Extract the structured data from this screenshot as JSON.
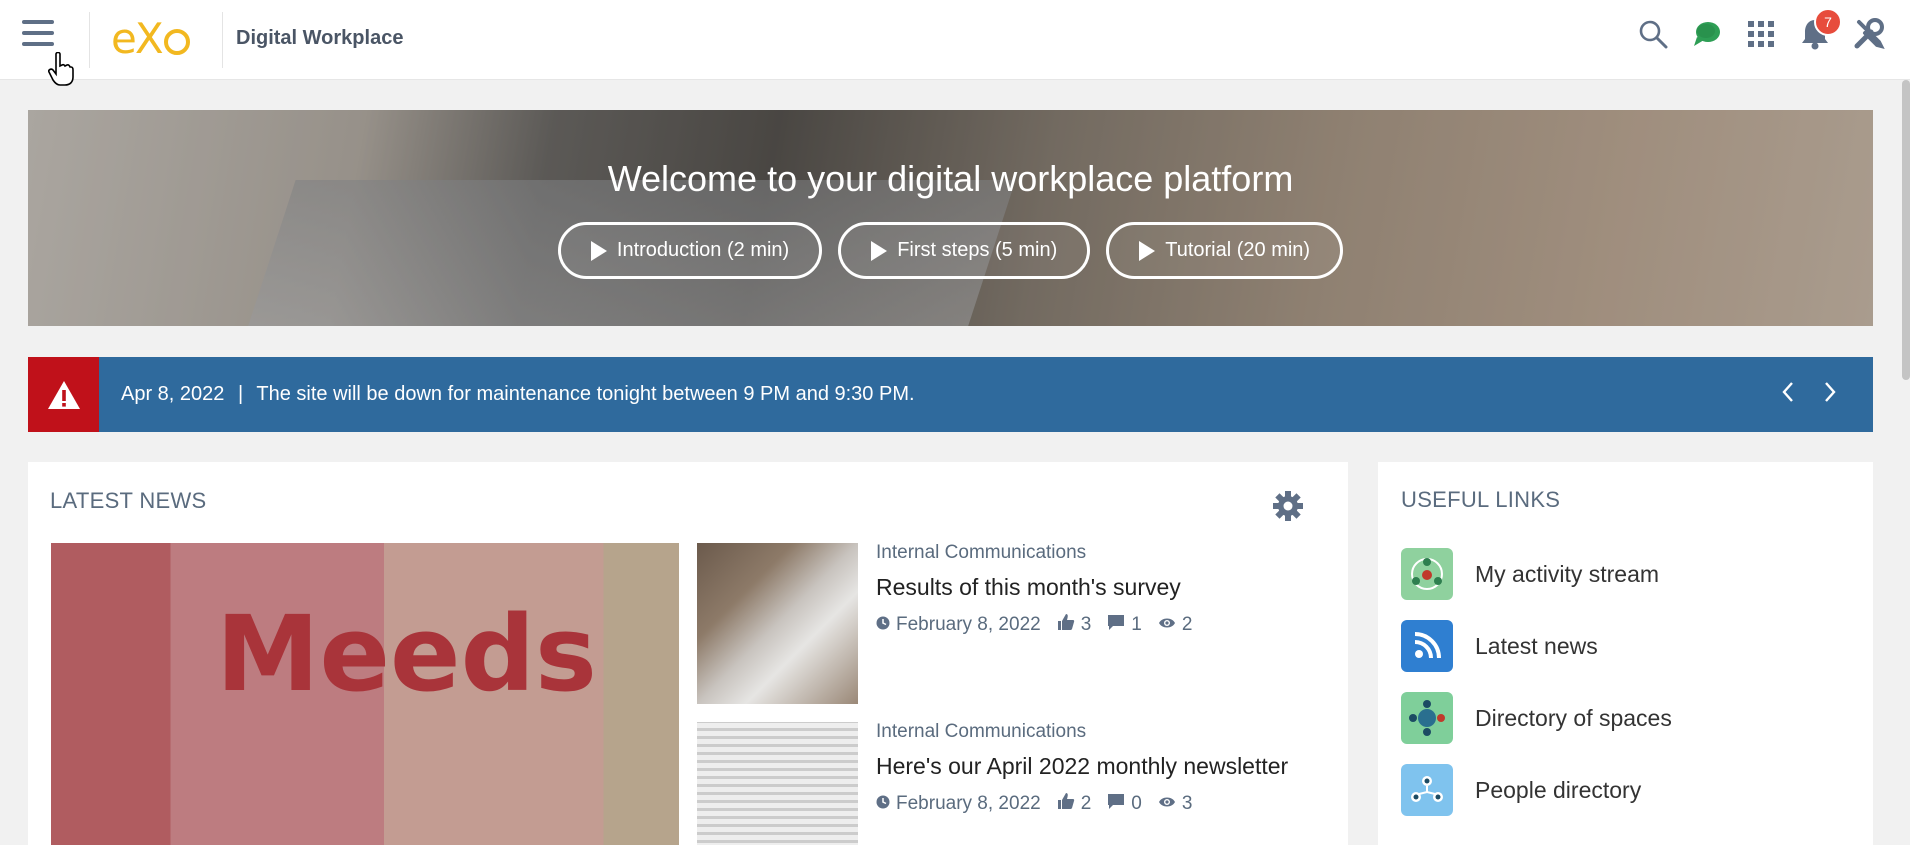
{
  "header": {
    "app_title": "Digital Workplace",
    "logo_text": "eXo",
    "notifications_count": "7"
  },
  "banner": {
    "title": "Welcome to your digital workplace platform",
    "buttons": [
      {
        "label": "Introduction (2 min)"
      },
      {
        "label": "First steps (5 min)"
      },
      {
        "label": "Tutorial (20 min)"
      }
    ]
  },
  "announcement": {
    "date": "Apr 8, 2022",
    "separator": "|",
    "message": "The site will be down for maintenance tonight between 9 PM and 9:30 PM."
  },
  "latest_news": {
    "title": "LATEST NEWS",
    "featured_image_text": "Meeds",
    "articles": [
      {
        "category": "Internal Communications",
        "title": "Results of this month's survey",
        "date": "February 8, 2022",
        "likes": "3",
        "comments": "1",
        "views": "2"
      },
      {
        "category": "Internal Communications",
        "title": "Here's our April 2022 monthly newsletter",
        "date": "February 8, 2022",
        "likes": "2",
        "comments": "0",
        "views": "3"
      }
    ]
  },
  "useful_links": {
    "title": "USEFUL LINKS",
    "items": [
      {
        "label": "My activity stream",
        "icon": "activity-stream-icon",
        "color": "#8fd19e"
      },
      {
        "label": "Latest news",
        "icon": "rss-icon",
        "color": "#2f7fd1"
      },
      {
        "label": "Directory of spaces",
        "icon": "spaces-icon",
        "color": "#7fcf9a"
      },
      {
        "label": "People directory",
        "icon": "people-icon",
        "color": "#7fc3ee"
      }
    ]
  },
  "colors": {
    "accent": "#2f6a9d",
    "alert": "#c0111a",
    "logo": "#f2b820",
    "badge": "#e74c3c"
  }
}
